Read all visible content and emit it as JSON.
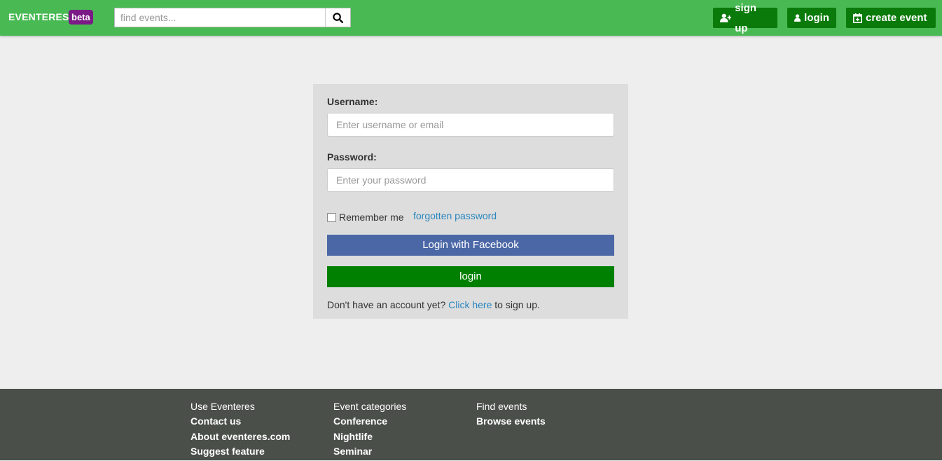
{
  "header": {
    "brand": "EVENTERES",
    "badge": "beta",
    "search_placeholder": "find events...",
    "buttons": {
      "signup": "sign up",
      "login": "login",
      "create": "create event"
    },
    "colors": {
      "bar": "#48b953",
      "button": "#0a7a0a",
      "badge": "#7b1a86"
    }
  },
  "login_form": {
    "username_label": "Username:",
    "username_placeholder": "Enter username or email",
    "password_label": "Password:",
    "password_placeholder": "Enter your password",
    "remember_label": "Remember me",
    "forgot_link": "forgotten password",
    "facebook_button": "Login with Facebook",
    "login_button": "login",
    "signup_prefix": "Don't have an account yet?",
    "signup_link": "Click here",
    "signup_suffix": "to sign up."
  },
  "footer": {
    "columns": [
      {
        "heading": "Use Eventeres",
        "links": [
          "Contact us",
          "About eventeres.com",
          "Suggest feature"
        ]
      },
      {
        "heading": "Event categories",
        "links": [
          "Conference",
          "Nightlife",
          "Seminar"
        ]
      },
      {
        "heading": "Find events",
        "links": [
          "Browse events"
        ]
      }
    ]
  }
}
